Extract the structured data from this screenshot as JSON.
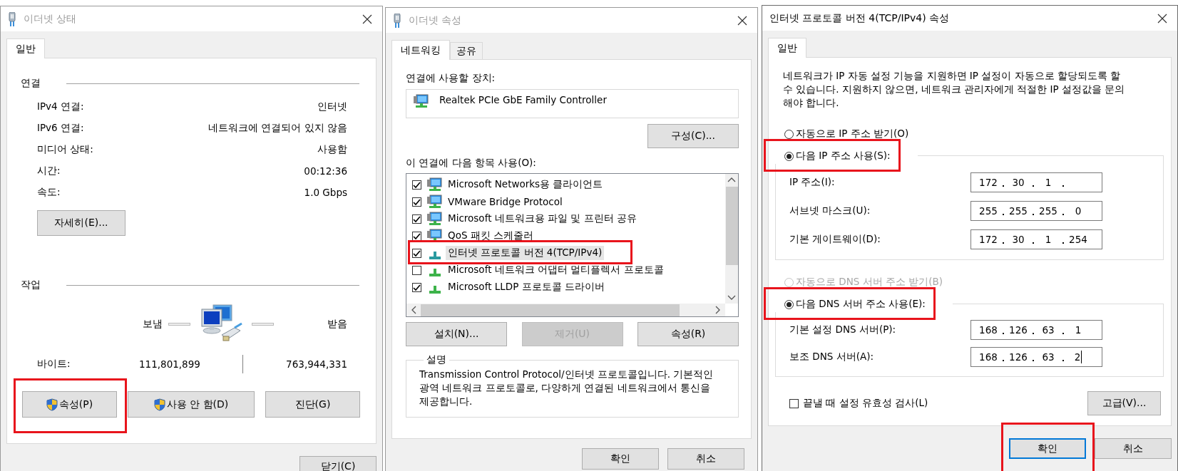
{
  "dialogs": [
    {
      "kind": "status",
      "active": false,
      "title": "이더넷 상태",
      "tabs": [
        {
          "label": "일반",
          "selected": true
        }
      ],
      "connection": {
        "heading": "연결",
        "rows": [
          {
            "label": "IPv4 연결:",
            "value": "인터넷"
          },
          {
            "label": "IPv6 연결:",
            "value": "네트워크에 연결되어 있지 않음"
          },
          {
            "label": "미디어 상태:",
            "value": "사용함"
          },
          {
            "label": "시간:",
            "value": "00:12:36"
          },
          {
            "label": "속도:",
            "value": "1.0 Gbps"
          }
        ]
      },
      "details_button": "자세히(E)...",
      "activity": {
        "heading": "작업",
        "sent_label": "보냄",
        "received_label": "받음",
        "bytes_label": "바이트:",
        "sent": "111,801,899",
        "received": "763,944,331"
      },
      "buttons": [
        {
          "label": "속성(P)",
          "elevated": true,
          "highlighted": true
        },
        {
          "label": "사용 안 함(D)",
          "elevated": true,
          "highlighted": false
        },
        {
          "label": "진단(G)",
          "elevated": false,
          "highlighted": false
        }
      ],
      "footer_buttons": [
        {
          "label": "닫기(C)",
          "default": false,
          "highlighted": false
        }
      ]
    },
    {
      "kind": "adapter",
      "active": false,
      "title": "이더넷 속성",
      "tabs": [
        {
          "label": "네트워킹",
          "selected": true
        },
        {
          "label": "공유",
          "selected": false
        }
      ],
      "device_label": "연결에 사용할 장치:",
      "device": "Realtek PCIe GbE Family Controller",
      "configure_button": "구성(C)...",
      "items_label": "이 연결에 다음 항목 사용(O):",
      "items": [
        {
          "label": "Microsoft Networks용 클라이언트",
          "kind": "computer",
          "checked": true,
          "selected": false,
          "highlighted": false
        },
        {
          "label": "VMware Bridge Protocol",
          "kind": "computer",
          "checked": true,
          "selected": false,
          "highlighted": false
        },
        {
          "label": "Microsoft 네트워크용 파일 및 프린터 공유",
          "kind": "computer",
          "checked": true,
          "selected": false,
          "highlighted": false
        },
        {
          "label": "QoS 패킷 스케줄러",
          "kind": "computer",
          "checked": true,
          "selected": false,
          "highlighted": false
        },
        {
          "label": "인터넷 프로토콜 버전 4(TCP/IPv4)",
          "kind": "protocol",
          "checked": true,
          "selected": true,
          "highlighted": true
        },
        {
          "label": "Microsoft 네트워크 어댑터 멀티플렉서 프로토콜",
          "kind": "protocol",
          "checked": false,
          "selected": false,
          "highlighted": false
        },
        {
          "label": "Microsoft LLDP 프로토콜 드라이버",
          "kind": "protocol",
          "checked": true,
          "selected": false,
          "highlighted": false
        }
      ],
      "item_buttons": [
        {
          "label": "설치(N)...",
          "disabled": false
        },
        {
          "label": "제거(U)",
          "disabled": true
        },
        {
          "label": "속성(R)",
          "disabled": false
        }
      ],
      "description_heading": "설명",
      "description": "Transmission Control Protocol/인터넷 프로토콜입니다. 기본적인 광역 네트워크 프로토콜로, 다양하게 연결된 네트워크에서 통신을 제공합니다.",
      "footer_buttons": [
        {
          "label": "확인",
          "default": false,
          "highlighted": false
        },
        {
          "label": "취소",
          "default": false,
          "highlighted": false
        }
      ]
    },
    {
      "kind": "ipv4",
      "active": true,
      "title": "인터넷 프로토콜 버전 4(TCP/IPv4) 속성",
      "tabs": [
        {
          "label": "일반",
          "selected": true
        }
      ],
      "intro": "네트워크가 IP 자동 설정 기능을 지원하면 IP 설정이 자동으로 할당되도록 할 수 있습니다. 지원하지 않으면, 네트워크 관리자에게 적절한 IP 설정값을 문의해야 합니다.",
      "sections": [
        {
          "auto_option": {
            "label": "자동으로 IP 주소 받기(O)",
            "selected": false,
            "disabled": false
          },
          "manual_option": {
            "label": "다음 IP 주소 사용(S):",
            "selected": true,
            "highlighted": true
          },
          "fields": [
            {
              "label": "IP 주소(I):",
              "octets": [
                "172",
                "30",
                "1"
              ],
              "focused": false
            },
            {
              "label": "서브넷 마스크(U):",
              "octets": [
                "255",
                "255",
                "255",
                "0"
              ],
              "focused": false
            },
            {
              "label": "기본 게이트웨이(D):",
              "octets": [
                "172",
                "30",
                "1",
                "254"
              ],
              "focused": false
            }
          ]
        },
        {
          "auto_option": {
            "label": "자동으로 DNS 서버 주소 받기(B)",
            "selected": false,
            "disabled": true
          },
          "manual_option": {
            "label": "다음 DNS 서버 주소 사용(E):",
            "selected": true,
            "highlighted": true
          },
          "fields": [
            {
              "label": "기본 설정 DNS 서버(P):",
              "octets": [
                "168",
                "126",
                "63",
                "1"
              ],
              "focused": false
            },
            {
              "label": "보조 DNS 서버(A):",
              "octets": [
                "168",
                "126",
                "63",
                "2"
              ],
              "focused": true
            }
          ]
        }
      ],
      "validate_checkbox": {
        "label": "끝낼 때 설정 유효성 검사(L)",
        "checked": false
      },
      "advanced_button": "고급(V)...",
      "footer_buttons": [
        {
          "label": "확인",
          "default": true,
          "highlighted": true
        },
        {
          "label": "취소",
          "default": false,
          "highlighted": false
        }
      ]
    }
  ]
}
